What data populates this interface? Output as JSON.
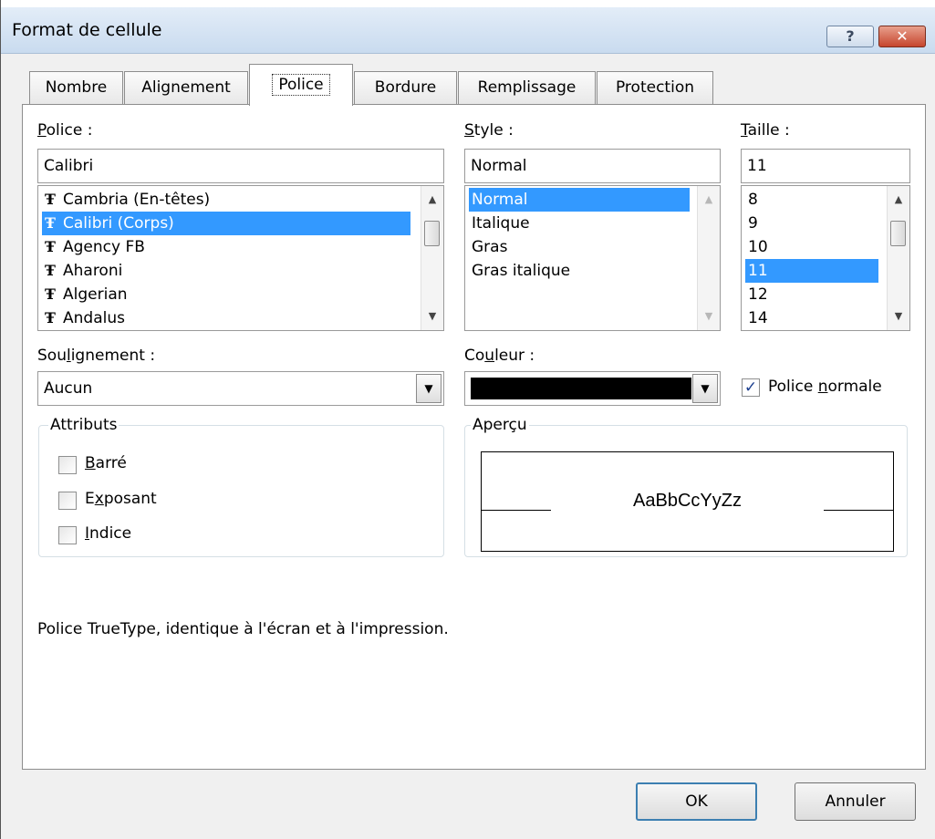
{
  "dialog": {
    "title": "Format de cellule",
    "help_label": "?",
    "close_label": "✕"
  },
  "tabs": [
    {
      "label": "Nombre"
    },
    {
      "label": "Alignement"
    },
    {
      "label": "Police",
      "active": true
    },
    {
      "label": "Bordure"
    },
    {
      "label": "Remplissage"
    },
    {
      "label": "Protection"
    }
  ],
  "font": {
    "label_accesskey": "P",
    "label_rest": "olice :",
    "value": "Calibri",
    "items": [
      {
        "icon": "truetype-icon",
        "label": "Cambria (En-têtes)"
      },
      {
        "icon": "truetype-icon",
        "label": "Calibri (Corps)",
        "selected": true
      },
      {
        "icon": "truetype-icon",
        "label": "Agency FB"
      },
      {
        "icon": "truetype-icon",
        "label": "Aharoni"
      },
      {
        "icon": "truetype-icon",
        "label": "Algerian"
      },
      {
        "icon": "truetype-icon",
        "label": "Andalus"
      }
    ]
  },
  "style": {
    "label_accesskey": "S",
    "label_rest": "tyle :",
    "value": "Normal",
    "items": [
      {
        "label": "Normal",
        "selected": true
      },
      {
        "label": "Italique"
      },
      {
        "label": "Gras"
      },
      {
        "label": "Gras italique"
      }
    ]
  },
  "size": {
    "label_accesskey": "T",
    "label_rest": "aille :",
    "value": "11",
    "items": [
      {
        "label": "8"
      },
      {
        "label": "9"
      },
      {
        "label": "10"
      },
      {
        "label": "11",
        "selected": true
      },
      {
        "label": "12"
      },
      {
        "label": "14"
      }
    ]
  },
  "underline": {
    "label_before": "Sou",
    "label_accesskey": "l",
    "label_after": "ignement :",
    "value": "Aucun"
  },
  "color": {
    "label_before": "Co",
    "label_accesskey": "u",
    "label_after": "leur :",
    "swatch": "#000000"
  },
  "normal_font": {
    "label_before": "Police ",
    "label_accesskey": "n",
    "label_after": "ormale",
    "checked": true
  },
  "attributes": {
    "title": "Attributs",
    "items": [
      {
        "accesskey": "B",
        "rest": "arré",
        "checked": false
      },
      {
        "before": "E",
        "accesskey": "x",
        "rest": "posant",
        "checked": false
      },
      {
        "accesskey": "I",
        "rest": "ndice",
        "checked": false
      }
    ]
  },
  "preview": {
    "title": "Aperçu",
    "sample": "AaBbCcYyZz"
  },
  "description": "Police TrueType, identique à l'écran et à l'impression.",
  "buttons": {
    "ok": "OK",
    "cancel": "Annuler"
  }
}
